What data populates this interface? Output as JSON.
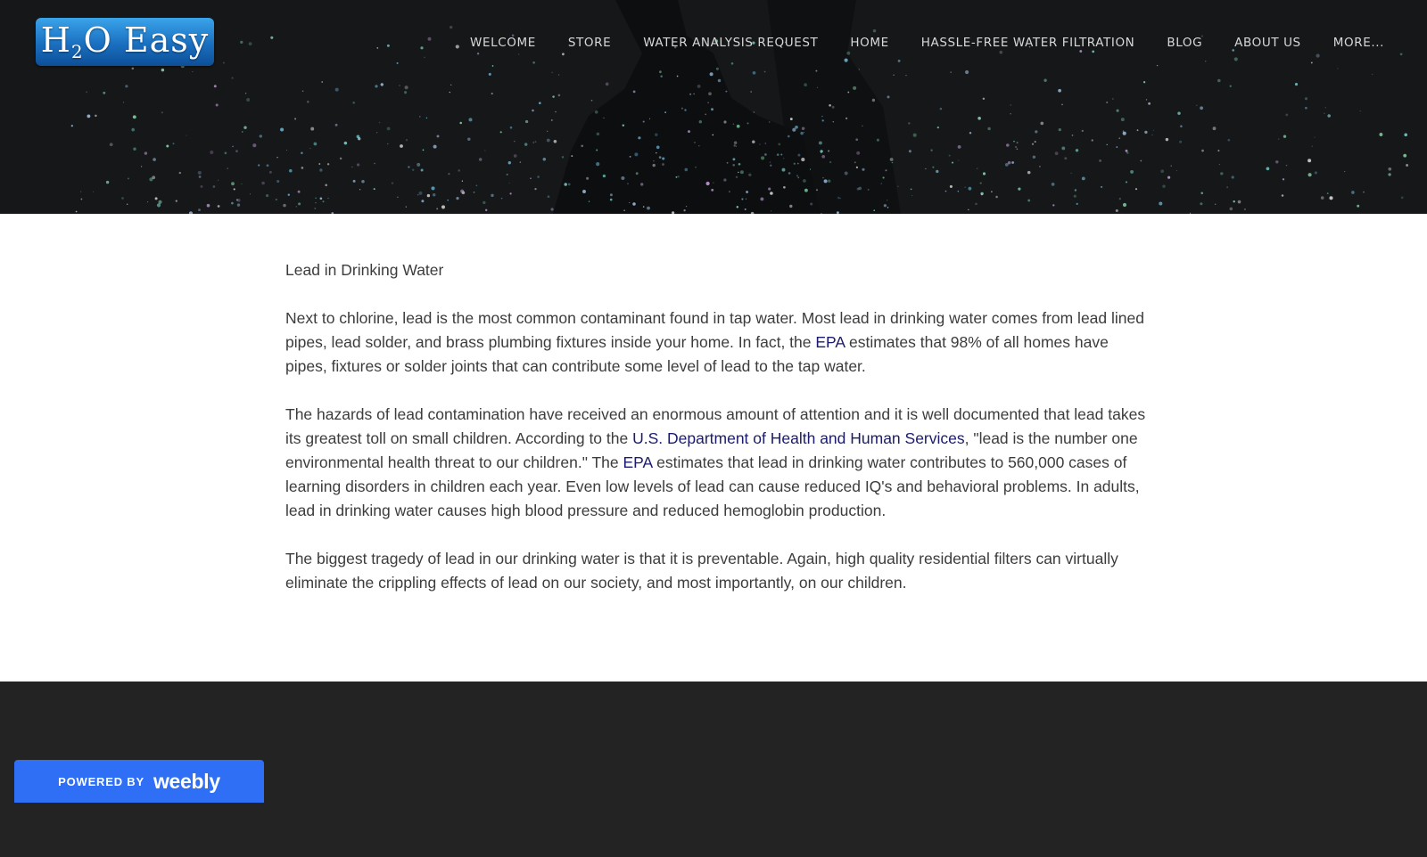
{
  "header": {
    "logo_text_h": "H",
    "logo_text_sub": "2",
    "logo_text_rest": "O Easy",
    "nav": [
      {
        "label": "WELCOME"
      },
      {
        "label": "STORE"
      },
      {
        "label": "WATER ANALYSIS REQUEST"
      },
      {
        "label": "HOME"
      },
      {
        "label": "HASSLE-FREE WATER FILTRATION"
      },
      {
        "label": "BLOG"
      },
      {
        "label": "ABOUT US"
      },
      {
        "label": "MORE..."
      }
    ]
  },
  "article": {
    "title": "Lead in Drinking Water",
    "p1_a": "Next to chlorine, lead is the most common contaminant found in tap water. Most lead in drinking water comes from lead lined pipes, lead solder, and brass plumbing fixtures inside your home. In fact, the ",
    "p1_link": "EPA",
    "p1_b": " estimates that 98% of all homes have pipes, fixtures or solder joints that can contribute some level of lead to the tap water.",
    "p2_a": "The hazards of lead contamination have received an enormous amount of attention and it is well documented that lead takes its greatest toll on small children. According to the ",
    "p2_link1": "U.S. Department of Health and Human Services",
    "p2_b": ", \"lead is the number one environmental health threat to our children.\" The ",
    "p2_link2": "EPA",
    "p2_c": " estimates that lead in drinking water contributes to 560,000 cases of learning disorders in children each year. Even low levels of lead can cause reduced IQ's and behavioral problems. In adults, lead in drinking water causes high blood pressure and reduced hemoglobin production.",
    "p3": "The biggest tragedy of lead in our drinking water is that it is preventable. Again, high quality residential filters can virtually eliminate the crippling effects of lead on our society, and most importantly, on our children."
  },
  "footer": {
    "powered_by": "POWERED BY",
    "weebly": "weebly"
  },
  "colors": {
    "link": "#1b1b6e",
    "badge": "#2e6ff6",
    "footer_bg": "#232323",
    "hero_bg": "#161718"
  }
}
